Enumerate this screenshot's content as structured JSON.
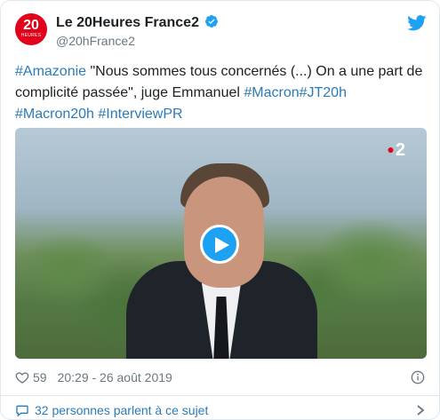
{
  "account": {
    "display_name": "Le 20Heures France2",
    "handle": "@20hFrance2",
    "avatar_number": "20",
    "avatar_sub": "HEURES"
  },
  "tweet": {
    "segments": [
      {
        "text": "#Amazonie",
        "type": "hashtag"
      },
      {
        "text": " \"Nous sommes tous concernés (...) On a une part de complicité passée\", juge Emmanuel ",
        "type": "text"
      },
      {
        "text": "#Macron",
        "type": "hashtag"
      },
      {
        "text": "#JT20h",
        "type": "hashtag"
      },
      {
        "text": " ",
        "type": "text"
      },
      {
        "text": "#Macron20h",
        "type": "hashtag"
      },
      {
        "text": " ",
        "type": "text"
      },
      {
        "text": "#InterviewPR",
        "type": "hashtag"
      }
    ]
  },
  "media": {
    "channel_logo": "2",
    "play_icon": "play-icon"
  },
  "meta": {
    "likes": "59",
    "timestamp": "20:29 - 26 août 2019"
  },
  "conversation": {
    "label": "32 personnes parlent à ce sujet"
  },
  "colors": {
    "link": "#2b7bb9",
    "verified": "#1da1f2",
    "brand_red": "#e2001a",
    "muted": "#697882"
  },
  "icons": [
    "verified-badge-icon",
    "twitter-bird-icon",
    "heart-icon",
    "info-icon",
    "comment-bubble-icon",
    "chevron-right-icon",
    "play-icon"
  ]
}
